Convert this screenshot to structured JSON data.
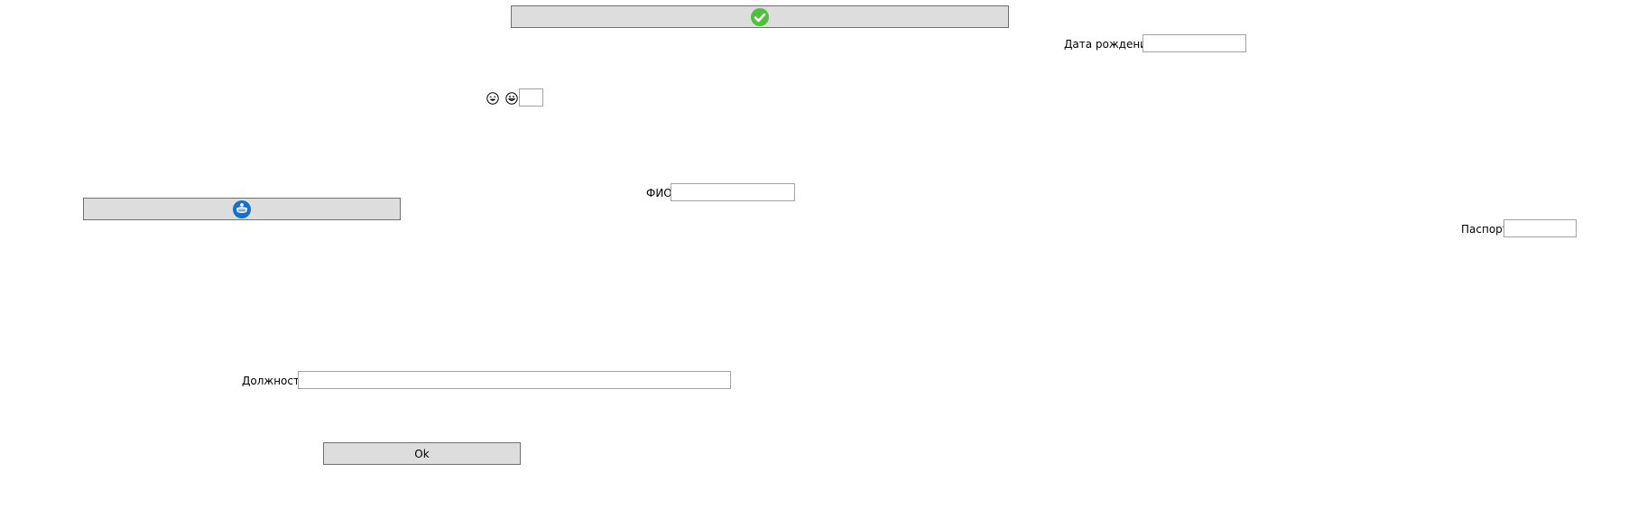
{
  "buttons": {
    "confirm_icon": "check-circle-icon",
    "confirm_icon_color": "#4fbf40",
    "medical_icon": "medical-mask-icon",
    "medical_icon_color": "#1570c8",
    "ok_label": "Ok"
  },
  "emojis": {
    "first": "laughing-face-icon",
    "second": "grinning-face-icon"
  },
  "fields": {
    "birth_date": {
      "label": "Дата рождения",
      "value": ""
    },
    "small": {
      "value": ""
    },
    "full_name": {
      "label": "ФИО",
      "value": ""
    },
    "passport": {
      "label": "Паспорт",
      "value": ""
    },
    "position": {
      "label": "Должность",
      "value": ""
    }
  },
  "colors": {
    "button_bg": "#dddddd",
    "button_border": "#707070",
    "field_border": "#a3a3a3"
  }
}
